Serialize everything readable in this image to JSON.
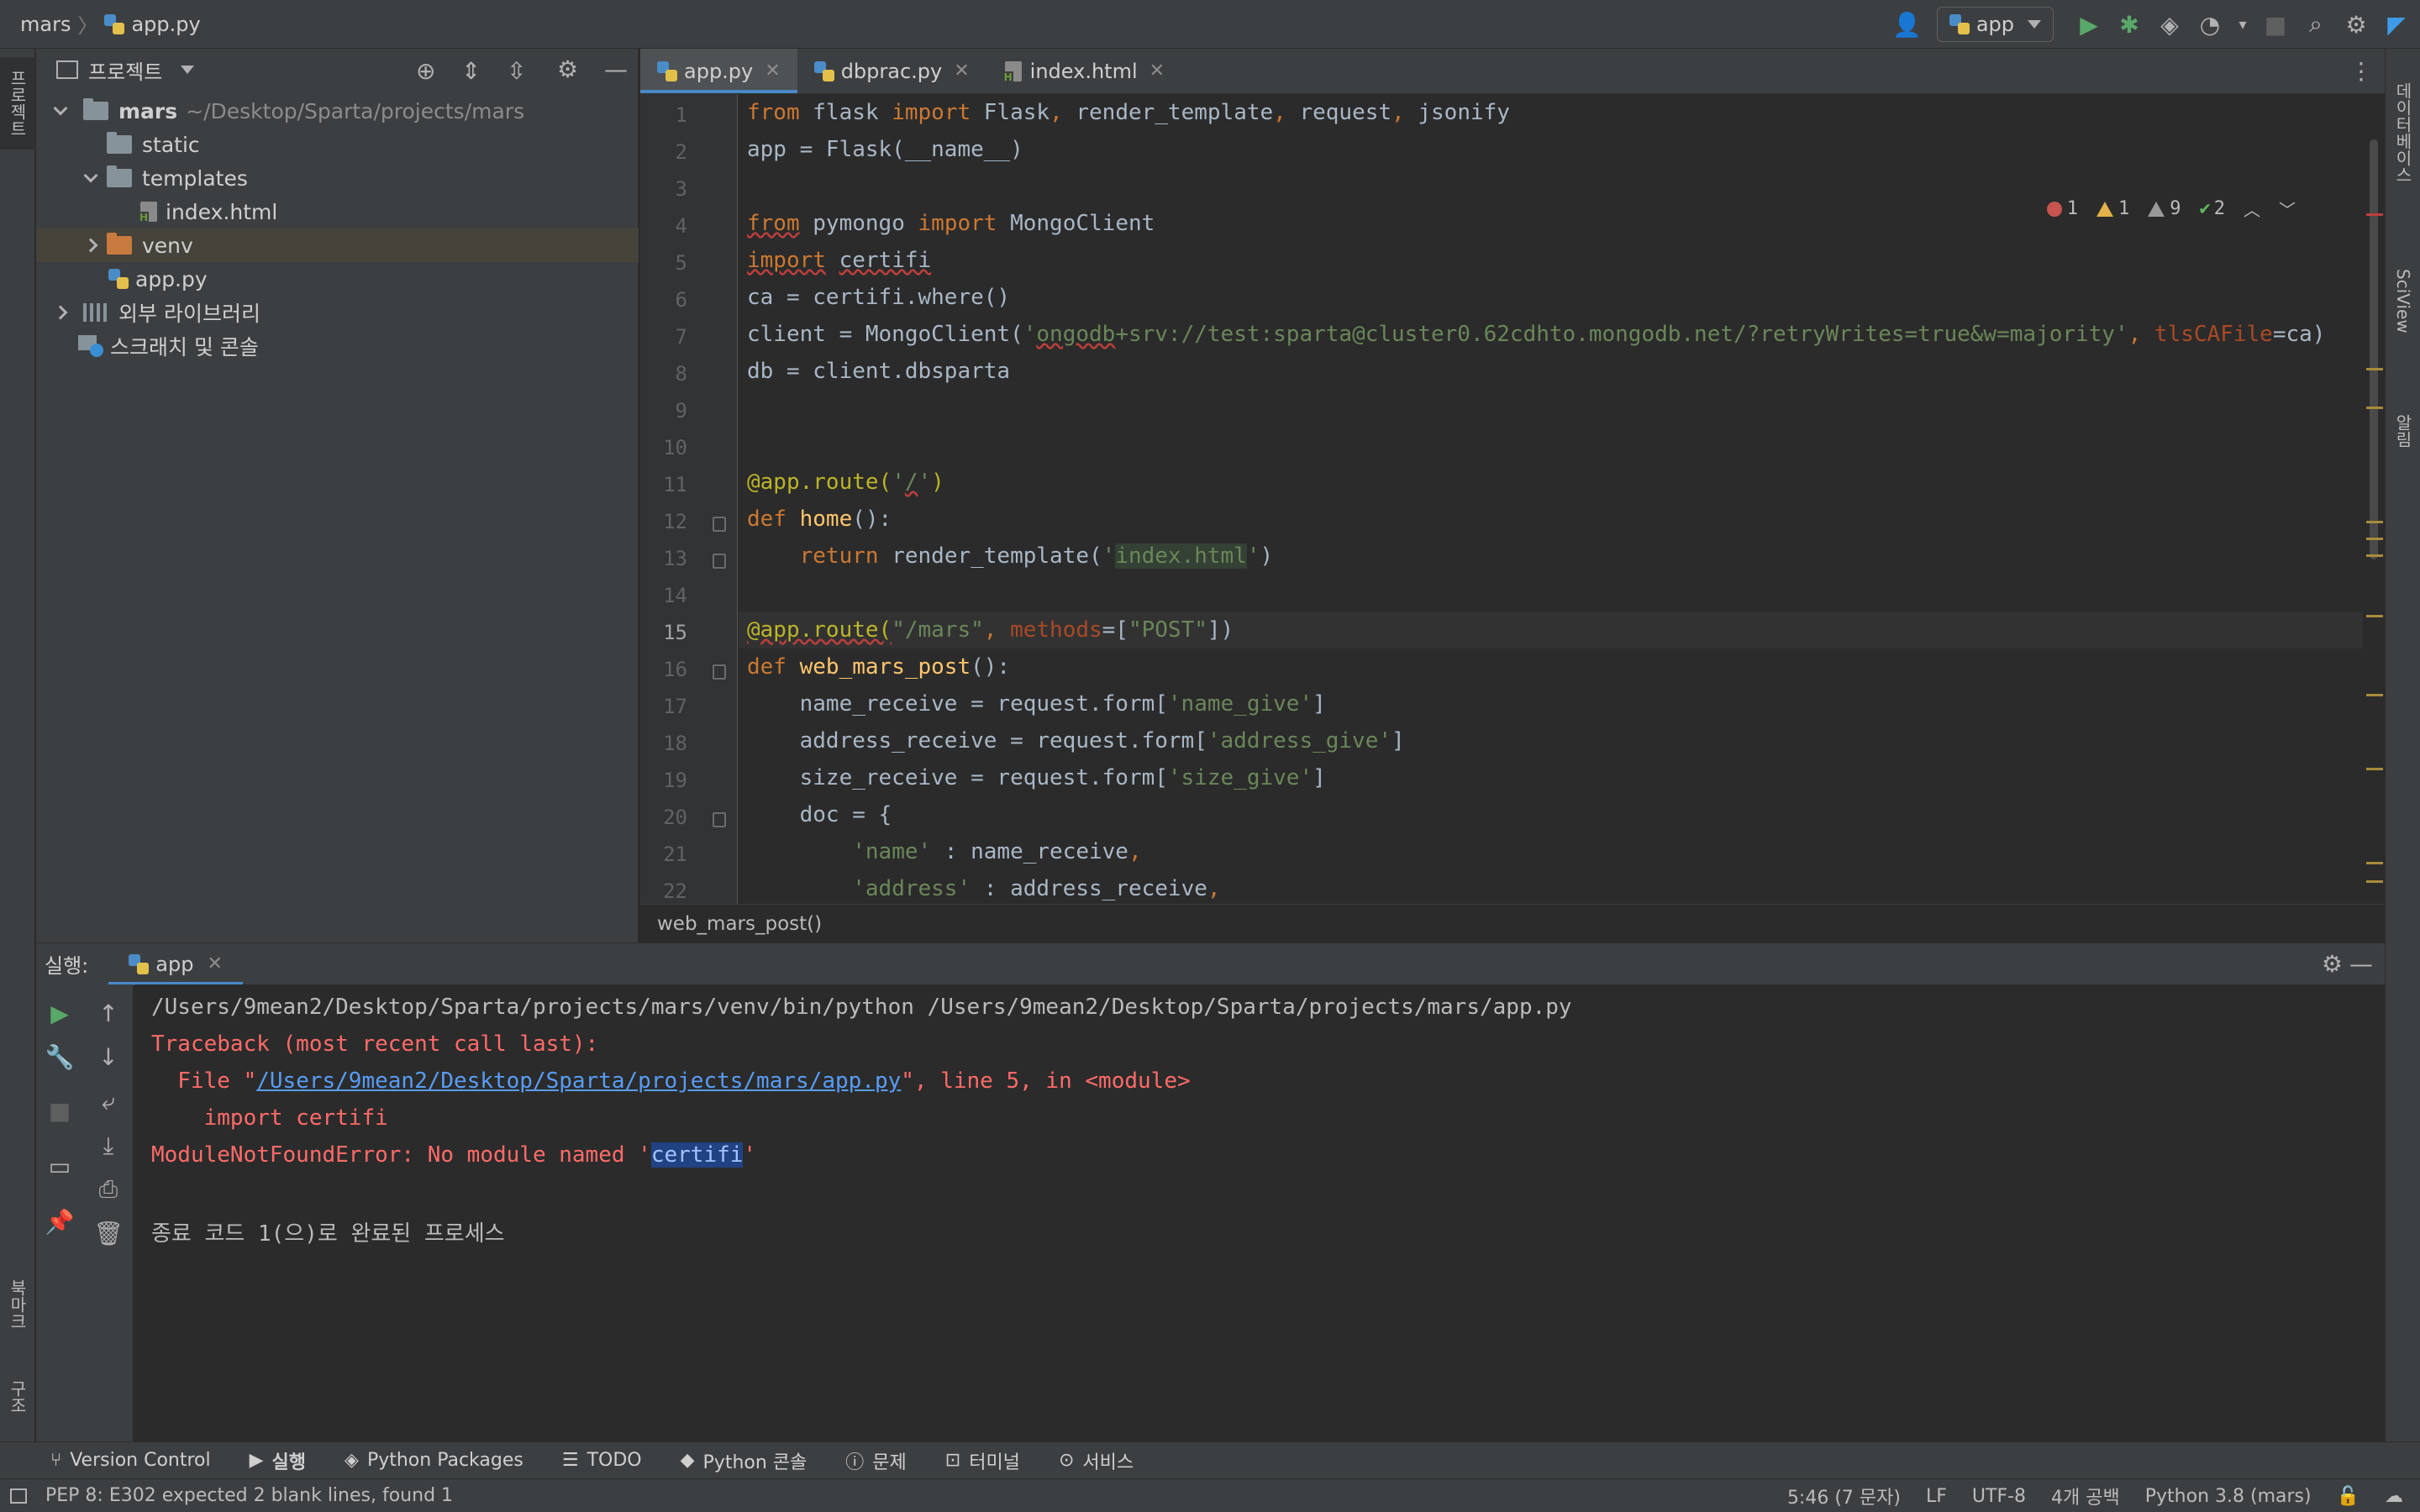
{
  "navbar": {
    "project": "mars",
    "file": "app.py",
    "run_config": "app"
  },
  "left_strip": {
    "project_tab": "프로젝트",
    "bookmarks_tab": "북마크",
    "structure_tab": "구조"
  },
  "right_strip": {
    "database_tab": "데이터베이스",
    "sciview_tab": "SciView",
    "notifications_tab": "알림"
  },
  "project_panel": {
    "title": "프로젝트",
    "root_name": "mars",
    "root_path": "~/Desktop/Sparta/projects/mars",
    "items": [
      {
        "label": "static"
      },
      {
        "label": "templates"
      },
      {
        "label": "index.html"
      },
      {
        "label": "venv"
      },
      {
        "label": "app.py"
      },
      {
        "label": "외부 라이브러리"
      },
      {
        "label": "스크래치 및 콘솔"
      }
    ]
  },
  "editor": {
    "tabs": [
      {
        "label": "app.py",
        "active": true
      },
      {
        "label": "dbprac.py",
        "active": false
      },
      {
        "label": "index.html",
        "active": false
      }
    ],
    "inspection": {
      "errors": "1",
      "warnings": "1",
      "weak_warnings": "9",
      "ok": "2"
    },
    "line_numbers": [
      "1",
      "2",
      "3",
      "4",
      "5",
      "6",
      "7",
      "8",
      "9",
      "10",
      "11",
      "12",
      "13",
      "14",
      "15",
      "16",
      "17",
      "18",
      "19",
      "20",
      "21",
      "22"
    ],
    "current_line": 15,
    "breadcrumb": "web_mars_post()"
  },
  "run_panel": {
    "label": "실행:",
    "tab": "app",
    "output": {
      "cmd": "/Users/9mean2/Desktop/Sparta/projects/mars/venv/bin/python /Users/9mean2/Desktop/Sparta/projects/mars/app.py",
      "traceback": "Traceback (most recent call last):",
      "file_prefix": "  File \"",
      "file_link": "/Users/9mean2/Desktop/Sparta/projects/mars/app.py",
      "file_suffix": "\", line 5, in <module>",
      "import_line": "    import certifi",
      "error_prefix": "ModuleNotFoundError: No module named '",
      "error_selected": "certifi",
      "error_suffix": "'",
      "exit": "종료 코드 1(으)로 완료된 프로세스"
    }
  },
  "bottom_tools": [
    {
      "label": "Version Control"
    },
    {
      "label": "실행"
    },
    {
      "label": "Python Packages"
    },
    {
      "label": "TODO"
    },
    {
      "label": "Python 콘솔"
    },
    {
      "label": "문제"
    },
    {
      "label": "터미널"
    },
    {
      "label": "서비스"
    }
  ],
  "status": {
    "message": "PEP 8: E302 expected 2 blank lines, found 1",
    "position": "5:46 (7 문자)",
    "line_sep": "LF",
    "encoding": "UTF-8",
    "indent": "4개 공백",
    "interpreter": "Python 3.8 (mars)"
  },
  "colors": {
    "keyword": "#cc7832",
    "string": "#6a8759",
    "decorator": "#bbb529",
    "function": "#ffc66d",
    "error_text": "#ff6b68",
    "accent": "#4a88c7"
  }
}
